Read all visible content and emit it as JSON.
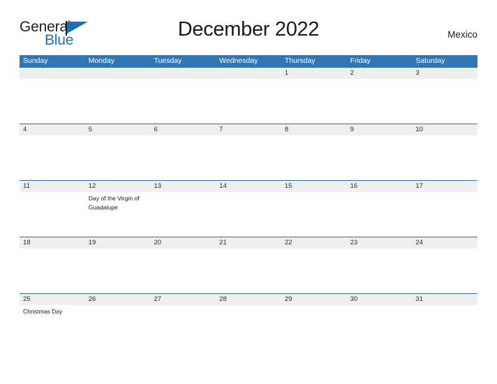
{
  "brand": {
    "name_line1": "General",
    "name_line2": "Blue",
    "mark": "triangle-flag",
    "color_dark": "#231f20",
    "color_blue": "#1f6fb4"
  },
  "header": {
    "title": "December 2022",
    "country": "Mexico"
  },
  "theme": {
    "header_blue": "#3076b4",
    "divider_blue": "#2f6fa8",
    "date_band_gray": "#efefef",
    "page_background": "#ffffff",
    "text_color": "#1a1a1a"
  },
  "calendar": {
    "month": "December",
    "year": "2022",
    "weekday_headers": [
      "Sunday",
      "Monday",
      "Tuesday",
      "Wednesday",
      "Thursday",
      "Friday",
      "Saturday"
    ],
    "weeks": [
      {
        "days": [
          {
            "date": "",
            "event": ""
          },
          {
            "date": "",
            "event": ""
          },
          {
            "date": "",
            "event": ""
          },
          {
            "date": "",
            "event": ""
          },
          {
            "date": "1",
            "event": ""
          },
          {
            "date": "2",
            "event": ""
          },
          {
            "date": "3",
            "event": ""
          }
        ]
      },
      {
        "days": [
          {
            "date": "4",
            "event": ""
          },
          {
            "date": "5",
            "event": ""
          },
          {
            "date": "6",
            "event": ""
          },
          {
            "date": "7",
            "event": ""
          },
          {
            "date": "8",
            "event": ""
          },
          {
            "date": "9",
            "event": ""
          },
          {
            "date": "10",
            "event": ""
          }
        ]
      },
      {
        "days": [
          {
            "date": "11",
            "event": ""
          },
          {
            "date": "12",
            "event": "Day of the Virgin of Guadalupe"
          },
          {
            "date": "13",
            "event": ""
          },
          {
            "date": "14",
            "event": ""
          },
          {
            "date": "15",
            "event": ""
          },
          {
            "date": "16",
            "event": ""
          },
          {
            "date": "17",
            "event": ""
          }
        ]
      },
      {
        "days": [
          {
            "date": "18",
            "event": ""
          },
          {
            "date": "19",
            "event": ""
          },
          {
            "date": "20",
            "event": ""
          },
          {
            "date": "21",
            "event": ""
          },
          {
            "date": "22",
            "event": ""
          },
          {
            "date": "23",
            "event": ""
          },
          {
            "date": "24",
            "event": ""
          }
        ]
      },
      {
        "days": [
          {
            "date": "25",
            "event": "Christmas Day"
          },
          {
            "date": "26",
            "event": ""
          },
          {
            "date": "27",
            "event": ""
          },
          {
            "date": "28",
            "event": ""
          },
          {
            "date": "29",
            "event": ""
          },
          {
            "date": "30",
            "event": ""
          },
          {
            "date": "31",
            "event": ""
          }
        ]
      }
    ]
  }
}
